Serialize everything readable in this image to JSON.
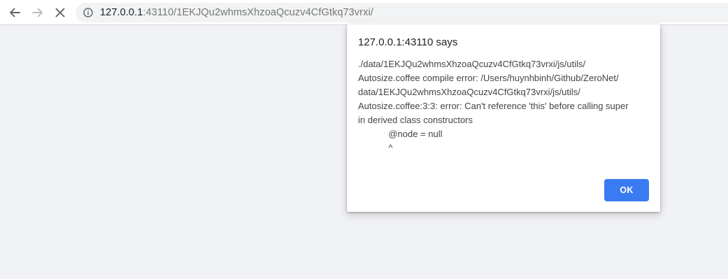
{
  "browser": {
    "address_bar": {
      "host": "127.0.0.1",
      "rest": ":43110/1EKJQu2whmsXhzoaQcuzv4CfGtkq73vrxi/"
    },
    "icons": {
      "back": "arrow-left-icon",
      "forward": "arrow-right-icon",
      "stop": "close-icon",
      "info": "info-icon"
    }
  },
  "dialog": {
    "title": "127.0.0.1:43110 says",
    "message": "./data/1EKJQu2whmsXhzoaQcuzv4CfGtkq73vrxi/js/utils/\nAutosize.coffee compile error: /Users/huynhbinh/Github/ZeroNet/\ndata/1EKJQu2whmsXhzoaQcuzv4CfGtkq73vrxi/js/utils/\nAutosize.coffee:3:3: error: Can't reference 'this' before calling super\nin derived class constructors\n            @node = null\n            ^",
    "ok_label": "OK"
  },
  "colors": {
    "page_background": "#f1f2f5",
    "omnibox_background": "#f1f3f4",
    "primary_button": "#3b7bf2"
  }
}
